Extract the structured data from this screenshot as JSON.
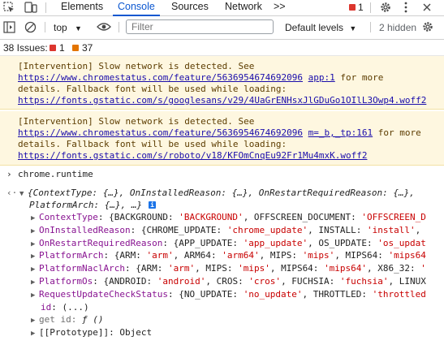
{
  "tabs": {
    "elements": "Elements",
    "console": "Console",
    "sources": "Sources",
    "network": "Network",
    "more": ">>",
    "error_count": "1"
  },
  "toolbar": {
    "context": "top",
    "filter_placeholder": "Filter",
    "levels": "Default levels",
    "hidden": "2 hidden"
  },
  "issues": {
    "label": "38 Issues:",
    "errors": "1",
    "warnings": "37"
  },
  "messages": [
    {
      "pre": "[Intervention] Slow network is detected. See ",
      "link": "https://www.chromestatus.com/feature/5636954674692096",
      "source": "app:1",
      "mid": " for more details. Fallback font will be used while loading: ",
      "font": "https://fonts.gstatic.com/s/googlesans/v29/4UaGrENHsxJlGDuGo1OIlL3Owp4.woff2"
    },
    {
      "pre": "[Intervention] Slow network is detected. See ",
      "link": "https://www.chromestatus.com/feature/5636954674692096",
      "source": "m=_b,_tp:161",
      "mid": " for more details. Fallback font will be used while loading: ",
      "font": "https://fonts.gstatic.com/s/roboto/v18/KFOmCnqEu92Fr1Mu4mxK.woff2"
    }
  ],
  "console": {
    "input": "chrome.runtime",
    "summary_line1": "{ContextType: {…}, OnInstalledReason: {…}, OnRestartRequiredReason: {…},",
    "summary_line2": "PlatformArch: {…}, …}",
    "props": [
      {
        "key": "ContextType",
        "text": "{BACKGROUND: 'BACKGROUND', OFFSCREEN_DOCUMENT: 'OFFSCREEN_D"
      },
      {
        "key": "OnInstalledReason",
        "text": "{CHROME_UPDATE: 'chrome_update', INSTALL: 'install', "
      },
      {
        "key": "OnRestartRequiredReason",
        "text": "{APP_UPDATE: 'app_update', OS_UPDATE: 'os_updat"
      },
      {
        "key": "PlatformArch",
        "text": "{ARM: 'arm', ARM64: 'arm64', MIPS: 'mips', MIPS64: 'mips64"
      },
      {
        "key": "PlatformNaclArch",
        "text": "{ARM: 'arm', MIPS: 'mips', MIPS64: 'mips64', X86_32: '"
      },
      {
        "key": "PlatformOs",
        "text": "{ANDROID: 'android', CROS: 'cros', FUCHSIA: 'fuchsia', LINUX"
      },
      {
        "key": "RequestUpdateCheckStatus",
        "text": "{NO_UPDATE: 'no_update', THROTTLED: 'throttled"
      }
    ],
    "id_line": "id: (...)",
    "getter": "get id: ƒ ()",
    "prototype": "[[Prototype]]: Object"
  }
}
